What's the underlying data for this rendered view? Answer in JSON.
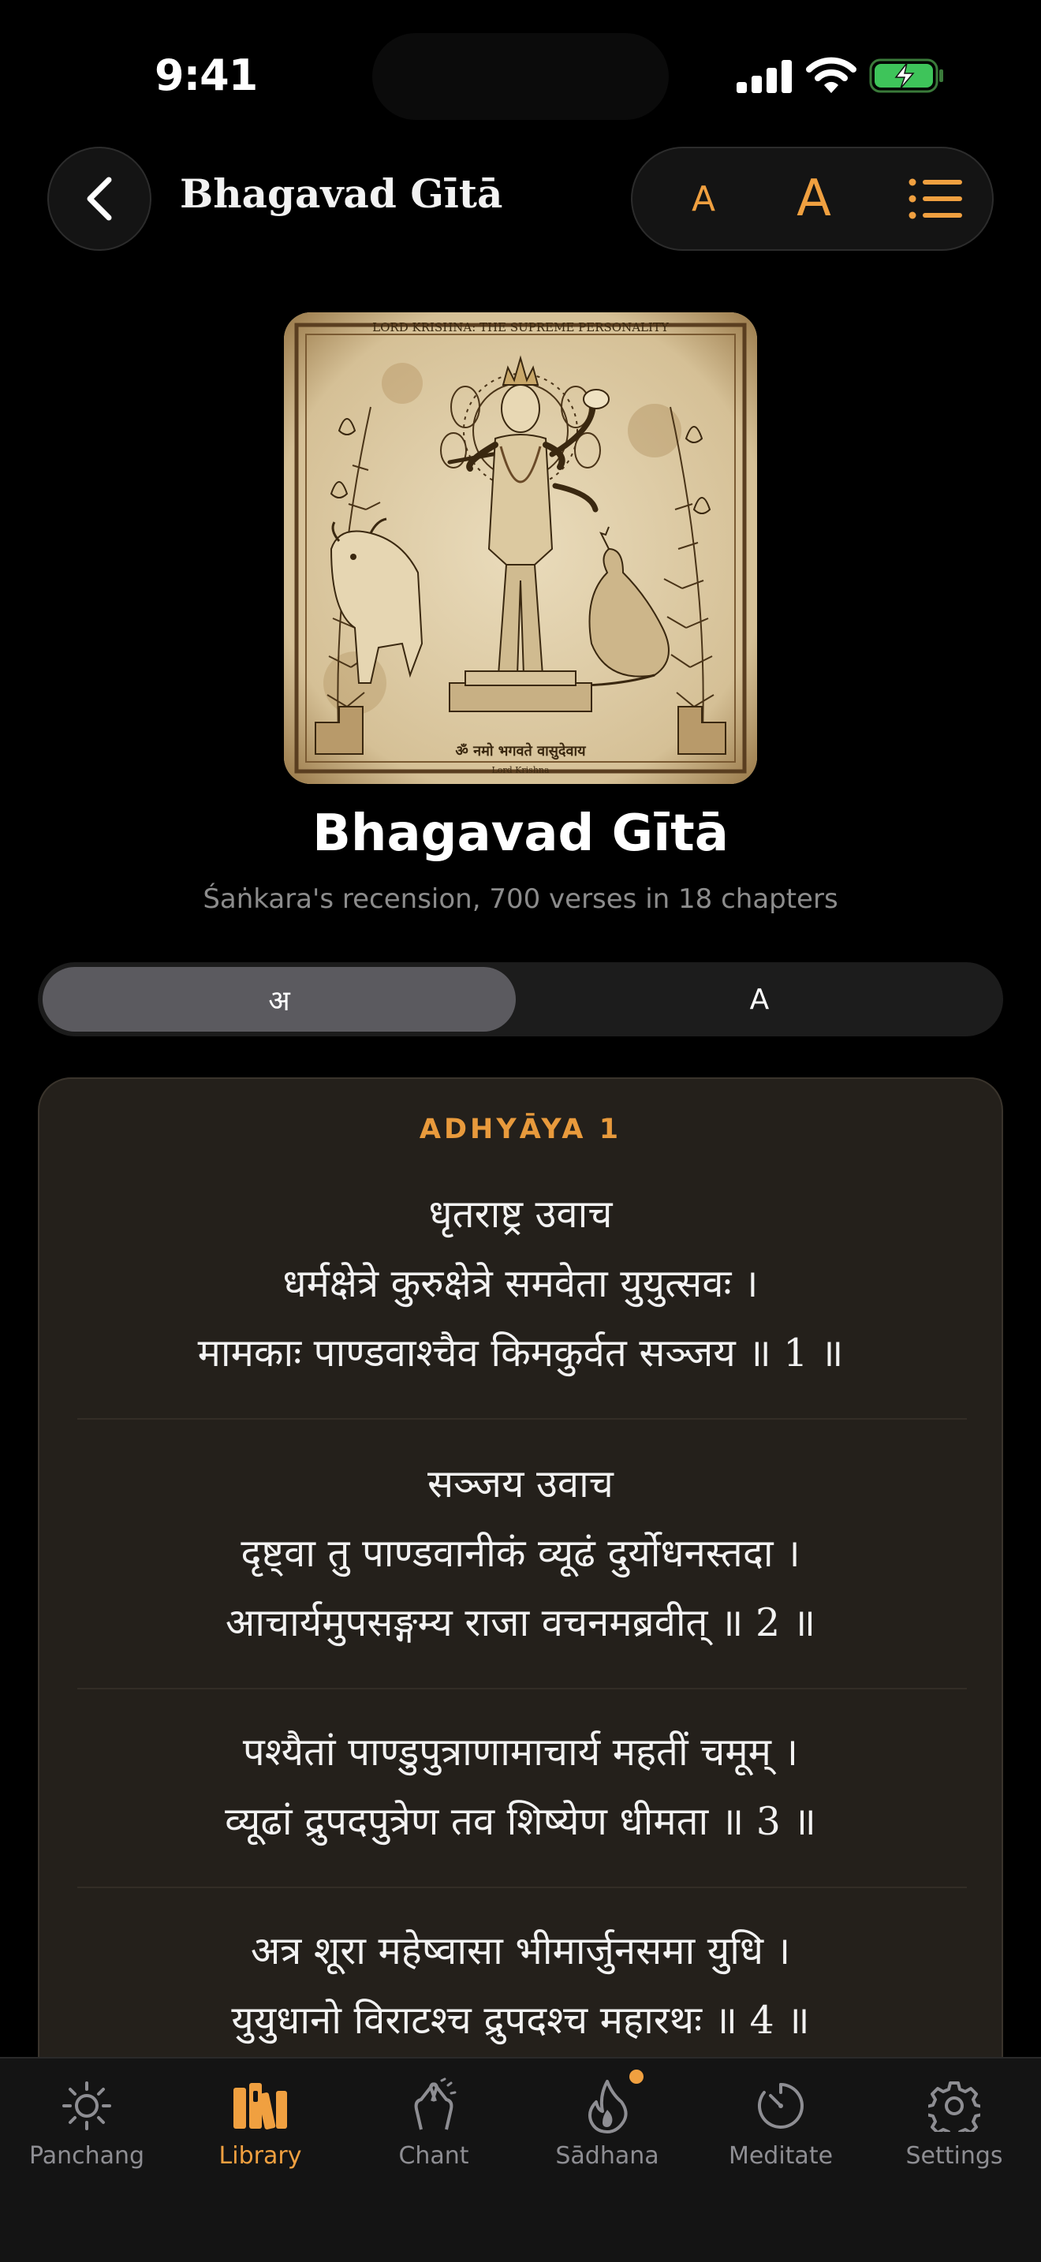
{
  "status_bar": {
    "time": "9:41"
  },
  "header": {
    "title": "Bhagavad Gītā",
    "font_small_label": "A",
    "font_large_label": "A"
  },
  "book": {
    "cover_caption_top": "LORD KRISHNA: THE SUPREME PERSONALITY",
    "cover_caption_bottom": "ॐ नमो भगवते वासुदेवाय",
    "cover_caption_small": "Lord Krishna",
    "title": "Bhagavad Gītā",
    "subtitle": "Śaṅkara's recension, 700 verses in 18 chapters"
  },
  "script_toggle": {
    "options": [
      "अ",
      "A"
    ],
    "selected": "अ"
  },
  "reader": {
    "chapter_label": "ADHYĀYA 1",
    "verses": [
      {
        "lines": [
          "धृतराष्ट्र उवाच",
          "धर्मक्षेत्रे कुरुक्षेत्रे समवेता युयुत्सवः ।",
          "मामकाः पाण्डवाश्चैव किमकुर्वत सञ्जय ॥ 1 ॥"
        ]
      },
      {
        "lines": [
          "सञ्जय उवाच",
          "दृष्ट्वा तु पाण्डवानीकं व्यूढं दुर्योधनस्तदा ।",
          "आचार्यमुपसङ्गम्य राजा वचनमब्रवीत् ॥ 2 ॥"
        ]
      },
      {
        "lines": [
          "पश्यैतां पाण्डुपुत्राणामाचार्य महतीं चमूम् ।",
          "व्यूढां द्रुपदपुत्रेण तव शिष्येण धीमता ॥ 3 ॥"
        ]
      },
      {
        "lines": [
          "अत्र शूरा महेष्वासा भीमार्जुनसमा युधि ।",
          "युयुधानो विराटश्च द्रुपदश्च महारथः ॥ 4 ॥"
        ]
      }
    ]
  },
  "tab_bar": {
    "active": "Library",
    "tabs": [
      {
        "label": "Panchang",
        "icon": "sun-icon"
      },
      {
        "label": "Library",
        "icon": "books-icon"
      },
      {
        "label": "Chant",
        "icon": "hands-icon"
      },
      {
        "label": "Sādhana",
        "icon": "flame-icon",
        "badge": true
      },
      {
        "label": "Meditate",
        "icon": "timer-icon"
      },
      {
        "label": "Settings",
        "icon": "gear-icon"
      }
    ]
  },
  "colors": {
    "accent": "#f0a040",
    "card_bg": "#24201b",
    "background": "#000000"
  }
}
